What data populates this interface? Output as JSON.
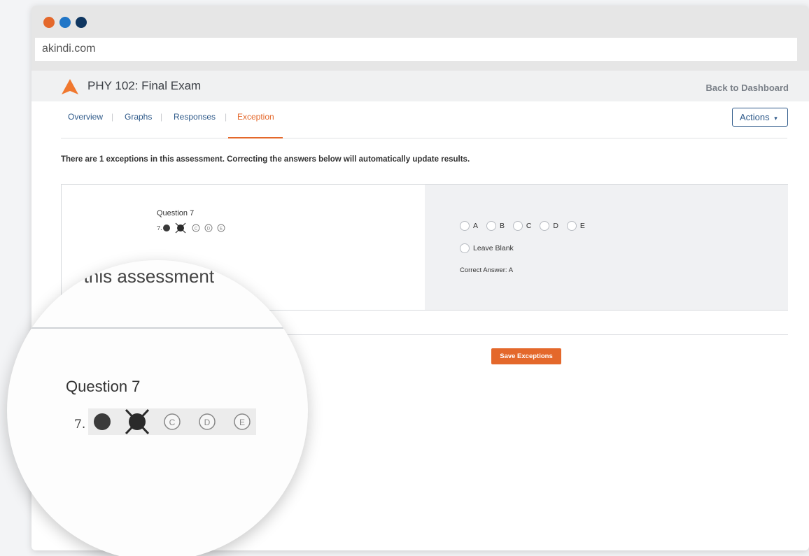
{
  "window": {
    "traffic_colors": [
      "#e4682b",
      "#2176c7",
      "#0f3660"
    ],
    "url": "akindi.com"
  },
  "header": {
    "logo_icon": "triangle-logo-icon",
    "logo_color": "#f0782f",
    "title": "PHY 102: Final Exam",
    "back_label": "Back to Dashboard"
  },
  "tabs": {
    "items": [
      "Overview",
      "Graphs",
      "Responses",
      "Exception"
    ],
    "active": "Exception",
    "separator": "|"
  },
  "actions": {
    "label": "Actions",
    "icon": "caret-down-icon"
  },
  "notice": "There are 1 exceptions in this assessment. Correcting the answers below will automatically update results.",
  "exception": {
    "question_title": "Question 7",
    "scan_number": "7.",
    "scan_letters": [
      "C",
      "D",
      "E"
    ],
    "options": [
      "A",
      "B",
      "C",
      "D",
      "E"
    ],
    "leave_blank": "Leave Blank",
    "correct_answer": "Correct Answer: A"
  },
  "save_label": "Save Exceptions",
  "magnifier": {
    "fragment_text": "n this assessment",
    "question_title": "Question 7",
    "scan_number": "7."
  },
  "colors": {
    "accent": "#e4682b",
    "link": "#2f5a8a"
  }
}
